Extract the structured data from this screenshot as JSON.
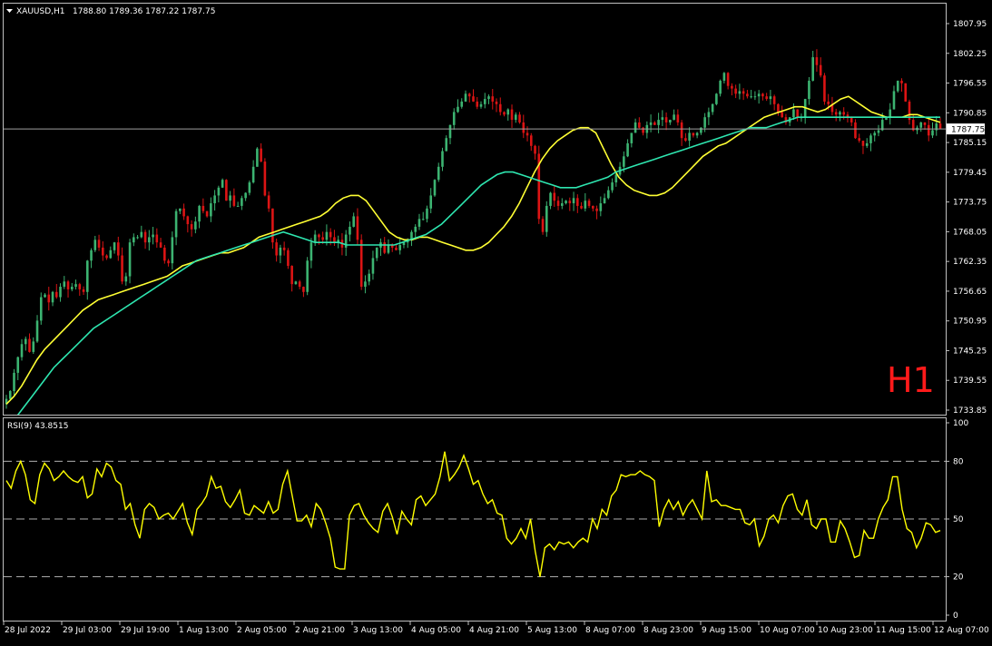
{
  "header": {
    "symbol": "XAUUSD,H1",
    "ohlc": "1788.80 1789.36 1787.22 1787.75"
  },
  "timeframe_label": "H1",
  "current_price_label": "1787.75",
  "colors": {
    "bg": "#000000",
    "frame": "#c0c0c0",
    "bull": "#3cb371",
    "bear": "#dc1414",
    "ma_fast": "#ffff33",
    "ma_slow": "#2ee6b0",
    "rsi": "#ffff00",
    "timeframe_label": "#ff1a1a",
    "price_line": "#a0a0a0"
  },
  "chart_data": [
    {
      "type": "candlestick",
      "title": "XAUUSD,H1",
      "ylim": [
        1733.85,
        1807.95
      ],
      "y_ticks": [
        "1807.95",
        "1802.25",
        "1796.55",
        "1790.85",
        "1785.15",
        "1779.45",
        "1773.75",
        "1768.05",
        "1762.35",
        "1756.65",
        "1750.95",
        "1745.25",
        "1739.55",
        "1733.85"
      ],
      "x_ticks": [
        "28 Jul 2022",
        "29 Jul 03:00",
        "29 Jul 19:00",
        "1 Aug 13:00",
        "2 Aug 05:00",
        "2 Aug 21:00",
        "3 Aug 13:00",
        "4 Aug 05:00",
        "4 Aug 21:00",
        "5 Aug 13:00",
        "8 Aug 07:00",
        "8 Aug 23:00",
        "9 Aug 15:00",
        "10 Aug 07:00",
        "10 Aug 23:00",
        "11 Aug 15:00",
        "12 Aug 07:00"
      ],
      "current_price": 1787.75,
      "close_path": [
        1736.0,
        1737.5,
        1741.0,
        1744.0,
        1746.5,
        1747.5,
        1745.0,
        1747.0,
        1751.0,
        1755.5,
        1756.0,
        1754.5,
        1756.5,
        1755.5,
        1757.5,
        1758.5,
        1757.0,
        1757.5,
        1758.0,
        1757.0,
        1756.5,
        1762.5,
        1764.5,
        1766.5,
        1765.0,
        1763.5,
        1763.0,
        1764.5,
        1766.0,
        1763.5,
        1758.5,
        1759.5,
        1766.0,
        1767.0,
        1767.0,
        1768.0,
        1766.0,
        1767.0,
        1767.5,
        1766.0,
        1765.0,
        1762.5,
        1762.0,
        1767.0,
        1772.0,
        1772.5,
        1771.0,
        1769.5,
        1768.5,
        1770.0,
        1773.0,
        1772.0,
        1771.0,
        1773.5,
        1775.0,
        1776.5,
        1778.0,
        1774.0,
        1775.0,
        1773.0,
        1773.0,
        1774.5,
        1775.5,
        1777.5,
        1780.5,
        1784.0,
        1781.5,
        1775.0,
        1772.5,
        1766.0,
        1763.5,
        1765.0,
        1764.5,
        1761.5,
        1758.0,
        1758.5,
        1757.5,
        1756.5,
        1762.5,
        1766.0,
        1767.5,
        1767.0,
        1766.5,
        1768.0,
        1767.0,
        1766.0,
        1766.5,
        1765.0,
        1767.5,
        1769.0,
        1771.0,
        1766.5,
        1757.5,
        1758.5,
        1760.0,
        1763.0,
        1765.0,
        1766.0,
        1764.0,
        1765.5,
        1765.0,
        1764.5,
        1765.5,
        1766.0,
        1766.5,
        1768.0,
        1769.0,
        1770.5,
        1770.5,
        1772.5,
        1775.0,
        1778.0,
        1780.5,
        1783.5,
        1786.0,
        1788.5,
        1791.0,
        1792.0,
        1793.0,
        1794.5,
        1794.0,
        1793.0,
        1792.0,
        1792.5,
        1793.5,
        1794.0,
        1793.0,
        1792.5,
        1791.0,
        1790.5,
        1791.5,
        1789.5,
        1790.5,
        1789.0,
        1787.0,
        1786.5,
        1784.5,
        1783.0,
        1770.5,
        1768.0,
        1773.0,
        1775.5,
        1774.0,
        1773.0,
        1773.5,
        1774.0,
        1773.5,
        1774.5,
        1773.0,
        1772.5,
        1774.0,
        1773.0,
        1772.5,
        1772.0,
        1773.5,
        1774.5,
        1776.0,
        1777.5,
        1779.0,
        1780.5,
        1782.5,
        1785.0,
        1787.0,
        1789.0,
        1788.0,
        1787.0,
        1788.5,
        1789.0,
        1788.5,
        1789.5,
        1790.0,
        1789.0,
        1789.5,
        1790.5,
        1789.0,
        1786.0,
        1785.5,
        1787.0,
        1786.5,
        1787.0,
        1788.0,
        1790.0,
        1791.0,
        1792.5,
        1794.5,
        1797.0,
        1798.5,
        1796.0,
        1795.5,
        1794.5,
        1795.0,
        1794.5,
        1794.0,
        1794.0,
        1794.0,
        1794.5,
        1794.0,
        1793.5,
        1794.0,
        1792.5,
        1791.0,
        1790.0,
        1789.0,
        1790.0,
        1791.5,
        1790.0,
        1790.0,
        1793.5,
        1797.0,
        1801.5,
        1800.0,
        1798.0,
        1793.0,
        1792.5,
        1791.0,
        1790.5,
        1791.0,
        1790.5,
        1790.0,
        1789.0,
        1786.0,
        1785.5,
        1784.5,
        1785.0,
        1786.5,
        1787.0,
        1787.5,
        1789.5,
        1790.0,
        1791.5,
        1795.0,
        1797.0,
        1796.5,
        1793.0,
        1789.5,
        1787.5,
        1788.0,
        1789.0,
        1788.5,
        1786.5,
        1787.5,
        1788.8,
        1787.75
      ],
      "series": [
        {
          "name": "",
          "type": "line",
          "period_hint": "fast MA",
          "values": [
            1735.0,
            1736.5,
            1738.5,
            1741.0,
            1743.5,
            1745.5,
            1747.0,
            1748.5,
            1750.0,
            1751.5,
            1753.0,
            1754.0,
            1755.0,
            1755.5,
            1756.0,
            1756.5,
            1757.0,
            1757.5,
            1758.0,
            1758.5,
            1759.0,
            1759.5,
            1760.5,
            1761.5,
            1762.0,
            1762.5,
            1763.0,
            1763.5,
            1764.0,
            1764.0,
            1764.5,
            1765.0,
            1766.0,
            1767.0,
            1767.5,
            1768.0,
            1768.5,
            1769.0,
            1769.5,
            1770.0,
            1770.5,
            1771.0,
            1772.0,
            1773.5,
            1774.5,
            1775.0,
            1775.0,
            1774.0,
            1772.0,
            1770.0,
            1768.0,
            1767.0,
            1766.5,
            1766.5,
            1767.0,
            1767.0,
            1766.5,
            1766.0,
            1765.5,
            1765.0,
            1764.5,
            1764.5,
            1765.0,
            1766.0,
            1767.5,
            1769.0,
            1771.0,
            1773.5,
            1776.5,
            1779.5,
            1782.0,
            1784.0,
            1785.5,
            1786.5,
            1787.5,
            1788.0,
            1788.0,
            1787.0,
            1784.0,
            1781.0,
            1778.5,
            1777.0,
            1776.0,
            1775.5,
            1775.0,
            1775.0,
            1775.5,
            1776.5,
            1778.0,
            1779.5,
            1781.0,
            1782.5,
            1783.5,
            1784.5,
            1785.0,
            1786.0,
            1787.0,
            1788.0,
            1789.0,
            1790.0,
            1790.5,
            1791.0,
            1791.5,
            1792.0,
            1792.0,
            1791.5,
            1791.0,
            1791.5,
            1792.5,
            1793.5,
            1794.0,
            1793.0,
            1792.0,
            1791.0,
            1790.5,
            1790.0,
            1790.0,
            1790.0,
            1790.5,
            1790.5,
            1790.0,
            1789.5,
            1789.0
          ]
        },
        {
          "name": "",
          "type": "line",
          "period_hint": "slow MA",
          "values": [
            1730.0,
            1732.0,
            1734.0,
            1736.0,
            1738.0,
            1740.0,
            1742.0,
            1743.5,
            1745.0,
            1746.5,
            1748.0,
            1749.5,
            1750.5,
            1751.5,
            1752.5,
            1753.5,
            1754.5,
            1755.5,
            1756.5,
            1757.5,
            1758.5,
            1759.5,
            1760.5,
            1761.5,
            1762.5,
            1763.0,
            1763.5,
            1764.0,
            1764.5,
            1765.0,
            1765.5,
            1766.0,
            1766.5,
            1767.0,
            1767.5,
            1768.0,
            1767.5,
            1767.0,
            1766.5,
            1766.0,
            1766.0,
            1766.0,
            1766.0,
            1765.5,
            1765.5,
            1765.5,
            1765.5,
            1765.5,
            1765.5,
            1765.5,
            1766.0,
            1766.5,
            1767.0,
            1767.5,
            1768.5,
            1769.5,
            1771.0,
            1772.5,
            1774.0,
            1775.5,
            1777.0,
            1778.0,
            1779.0,
            1779.5,
            1779.5,
            1779.0,
            1778.5,
            1778.0,
            1777.5,
            1777.0,
            1776.5,
            1776.5,
            1776.5,
            1777.0,
            1777.5,
            1778.0,
            1778.5,
            1779.5,
            1780.0,
            1780.5,
            1781.0,
            1781.5,
            1782.0,
            1782.5,
            1783.0,
            1783.5,
            1784.0,
            1784.5,
            1785.0,
            1785.5,
            1786.0,
            1786.5,
            1787.0,
            1787.5,
            1788.0,
            1788.0,
            1788.0,
            1788.5,
            1789.0,
            1789.5,
            1790.0,
            1790.0,
            1790.0,
            1790.0,
            1790.0,
            1790.0,
            1790.0,
            1790.0,
            1790.0,
            1790.0,
            1790.0,
            1790.0,
            1790.0,
            1790.0,
            1790.0,
            1790.0,
            1790.0,
            1790.0,
            1790.0
          ]
        }
      ]
    },
    {
      "type": "line",
      "title": "RSI(9) 43.8515",
      "ylim": [
        0,
        100
      ],
      "y_ticks": [
        100,
        80,
        50,
        20,
        0
      ],
      "levels": [
        80,
        50,
        20
      ],
      "series": [
        {
          "name": "RSI(9)",
          "values": [
            70,
            66,
            75,
            80,
            73,
            60,
            58,
            73,
            79,
            76,
            70,
            72,
            75,
            72,
            70,
            69,
            72,
            61,
            63,
            76,
            72,
            79,
            77,
            70,
            68,
            55,
            58,
            47,
            40,
            55,
            58,
            56,
            50,
            52,
            53,
            50,
            54,
            58,
            48,
            42,
            55,
            58,
            62,
            72,
            66,
            67,
            59,
            56,
            60,
            65,
            53,
            52,
            57,
            55,
            53,
            59,
            53,
            55,
            68,
            75,
            62,
            49,
            49,
            52,
            46,
            58,
            55,
            48,
            40,
            25,
            24,
            24,
            52,
            57,
            58,
            52,
            48,
            45,
            43,
            54,
            58,
            51,
            42,
            54,
            50,
            47,
            60,
            62,
            57,
            60,
            63,
            72,
            85,
            70,
            73,
            77,
            83,
            76,
            68,
            70,
            63,
            58,
            60,
            53,
            52,
            40,
            37,
            40,
            45,
            40,
            50,
            33,
            20,
            35,
            37,
            34,
            38,
            37,
            38,
            35,
            38,
            40,
            38,
            50,
            45,
            55,
            52,
            62,
            65,
            73,
            72,
            73,
            73,
            75,
            73,
            72,
            70,
            46,
            55,
            60,
            55,
            59,
            52,
            57,
            60,
            55,
            50,
            75,
            59,
            60,
            57,
            57,
            56,
            55,
            55,
            48,
            47,
            50,
            36,
            41,
            50,
            52,
            48,
            57,
            62,
            63,
            55,
            52,
            60,
            47,
            45,
            50,
            50,
            38,
            38,
            49,
            45,
            38,
            30,
            31,
            44,
            40,
            40,
            50,
            56,
            60,
            72,
            72,
            55,
            45,
            43,
            35,
            40,
            48,
            47,
            43,
            44
          ]
        }
      ]
    }
  ]
}
